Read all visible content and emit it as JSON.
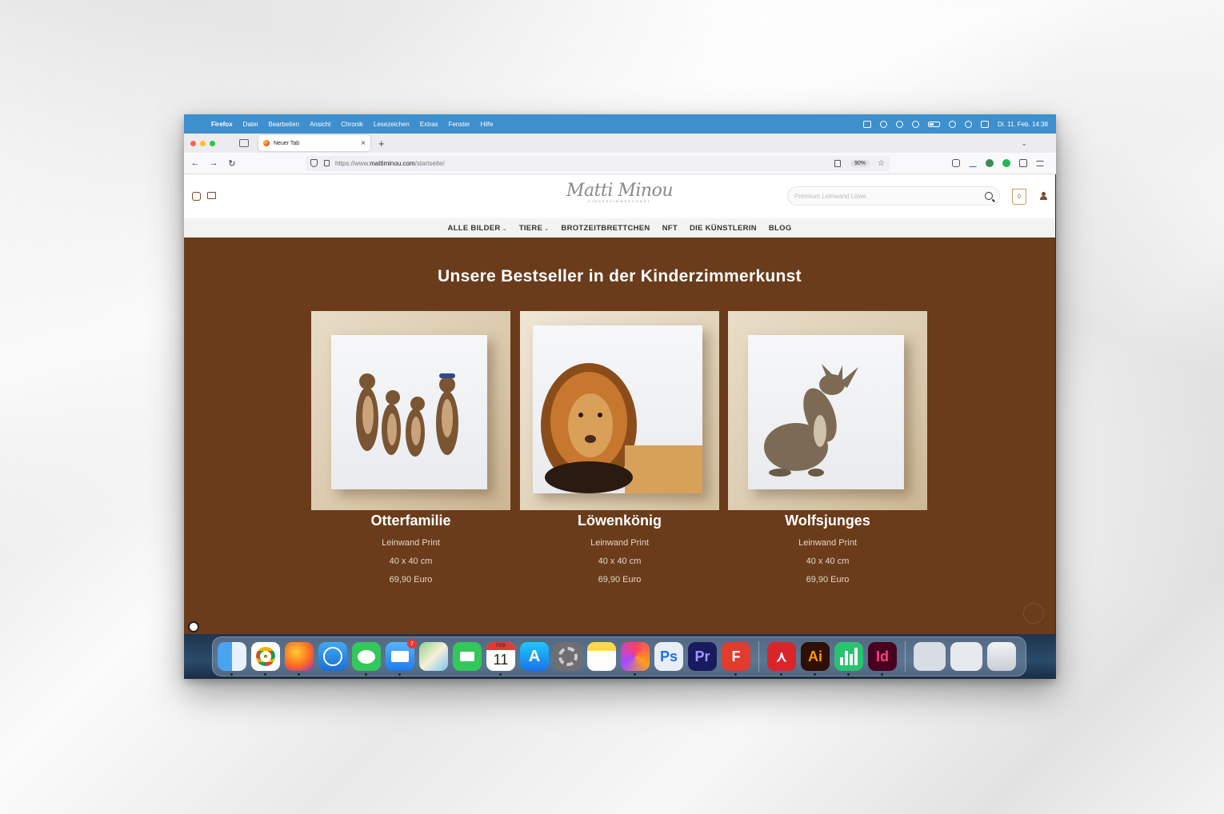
{
  "menubar": {
    "app_name": "Firefox",
    "items": [
      "Datei",
      "Bearbeiten",
      "Ansicht",
      "Chronik",
      "Lesezeichen",
      "Extras",
      "Fenster",
      "Hilfe"
    ],
    "datetime": "Di. 11. Feb. 14:38"
  },
  "browser": {
    "tab_title": "Neuer Tab",
    "url_prefix": "https://www.",
    "url_domain": "mattiminou.com",
    "url_path": "/startseite/",
    "zoom": "90%"
  },
  "site": {
    "logo_name": "Matti Minou",
    "logo_tagline": "KINDERZIMMERKUNST",
    "search_placeholder": "Premium Leinwand Löwe",
    "cart_count": "0",
    "nav": [
      "ALLE BILDER",
      "TIERE",
      "BROTZEITBRETTCHEN",
      "NFT",
      "DIE KÜNSTLERIN",
      "BLOG"
    ],
    "hero_title": "Unsere Bestseller in der Kinderzimmerkunst",
    "products": [
      {
        "name": "Otterfamilie",
        "type": "Leinwand Print",
        "size": "40 x 40 cm",
        "price": "69,90 Euro"
      },
      {
        "name": "Löwenkönig",
        "type": "Leinwand Print",
        "size": "40 x 40 cm",
        "price": "69,90 Euro"
      },
      {
        "name": "Wolfsjunges",
        "type": "Leinwand Print",
        "size": "40 x 40 cm",
        "price": "69,90 Euro"
      }
    ]
  },
  "dock": {
    "apps": [
      "Finder",
      "Chrome",
      "Firefox",
      "Safari",
      "Messages",
      "Mail",
      "Maps",
      "FaceTime",
      "Calendar",
      "App Store",
      "System Settings",
      "Notes",
      "Creative Cloud",
      "Ps",
      "Pr",
      "Fantastical",
      "Acrobat",
      "Ai",
      "Numbers",
      "Id"
    ],
    "mail_badge": "7",
    "calendar_month": "FEB",
    "calendar_day": "11"
  }
}
